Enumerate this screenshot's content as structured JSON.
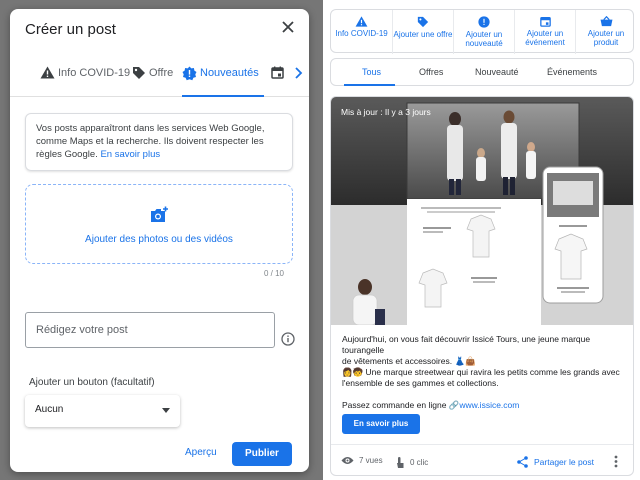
{
  "dialog": {
    "title": "Créer un post",
    "tabs": [
      {
        "label": "Info COVID-19"
      },
      {
        "label": "Offre"
      },
      {
        "label": "Nouveautés"
      },
      {
        "label": ""
      }
    ],
    "info_text": "Vos posts apparaîtront dans les services Web Google, comme Maps et la recherche. Ils doivent respecter les règles Google.",
    "info_link": "En savoir plus",
    "upload_label": "Ajouter des photos ou des vidéos",
    "counter": "0 / 10",
    "textarea_placeholder": "Rédigez votre post",
    "button_section_label": "Ajouter un bouton (facultatif)",
    "select_value": "Aucun",
    "preview_label": "Aperçu",
    "publish_label": "Publier"
  },
  "actions": [
    {
      "label": "Info COVID-19",
      "icon": "warning-icon"
    },
    {
      "label": "Ajouter une offre",
      "icon": "tag-icon"
    },
    {
      "label": "Ajouter un nouveauté",
      "icon": "new-icon"
    },
    {
      "label": "Ajouter un événement",
      "icon": "calendar-icon"
    },
    {
      "label": "Ajouter un produit",
      "icon": "basket-icon"
    }
  ],
  "filter_tabs": [
    "Tous",
    "Offres",
    "Nouveauté",
    "Événements"
  ],
  "post": {
    "updated": "Mis à jour : Il y a 3 jours",
    "text_lines": [
      "Aujourd'hui, on vous fait découvrir Issicé Tours, une jeune marque tourangelle",
      "de vêtements et accessoires. 👗👜",
      "👩🧒 Une marque streetwear qui ravira les petits comme les grands avec",
      "l'ensemble de ses gammes et collections."
    ],
    "order_text": "Passez commande en ligne 🔗",
    "order_link": "www.issice.com",
    "cta_label": "En savoir plus",
    "views": "7 vues",
    "clicks": "0 clic",
    "share_label": "Partager le post"
  },
  "colors": {
    "accent": "#1a73e8",
    "overlay": "#767676"
  }
}
